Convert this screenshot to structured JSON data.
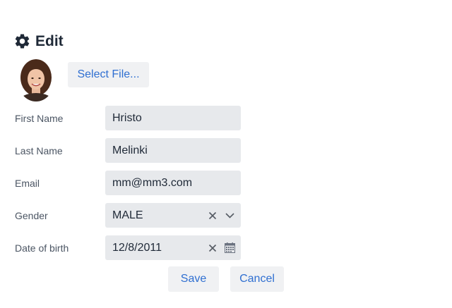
{
  "header": {
    "title": "Edit",
    "icon": "gear-icon"
  },
  "avatar": {
    "description_icon": "user-photo"
  },
  "buttons": {
    "select_file": "Select File...",
    "save": "Save",
    "cancel": "Cancel"
  },
  "form": {
    "first_name": {
      "label": "First Name",
      "value": "Hristo"
    },
    "last_name": {
      "label": "Last Name",
      "value": "Melinki"
    },
    "email": {
      "label": "Email",
      "value": "mm@mm3.com"
    },
    "gender": {
      "label": "Gender",
      "value": "MALE"
    },
    "date_of_birth": {
      "label": "Date of birth",
      "value": "12/8/2011"
    }
  },
  "colors": {
    "accent": "#2f6fd1",
    "field_bg": "#e7e9ec",
    "button_bg": "#f0f1f3"
  }
}
